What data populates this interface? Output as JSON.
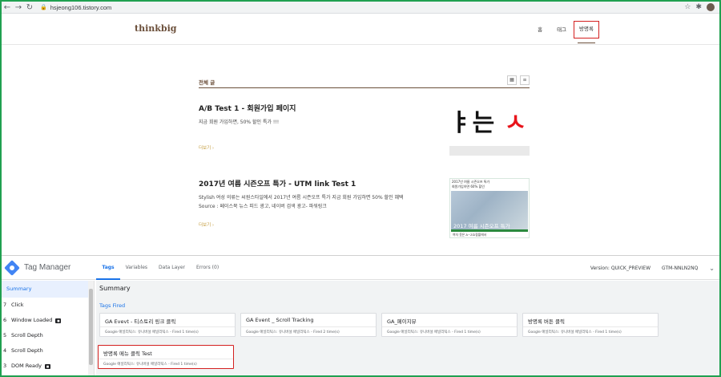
{
  "browser": {
    "url": "hsjeong106.tistory.com",
    "icons": [
      "back-arrow-icon",
      "forward-arrow-icon",
      "reload-icon",
      "lock-icon",
      "star-icon",
      "extensions-icon"
    ]
  },
  "blog": {
    "logo": "thinkbig",
    "nav": [
      "홈",
      "태그",
      "방명록"
    ],
    "section_title": "전체 글",
    "posts": [
      {
        "title": "A/B Test 1 - 회원가입 페이지",
        "excerpt": "지금 회원 가입하면, 50% 할인 특가 !!!",
        "more": "더보기 ›",
        "thumb_text": "ㅑ는 ",
        "thumb_text_red": "ㅅ"
      },
      {
        "title": "2017년 여름 시즌오프 특가 - UTM link Test 1",
        "excerpt_line1": "Stylish 여성 의류는 씨원스타일에서 2017년 여름 시즌오프 특가 지금 회원 가입하면 50% 할인 혜택",
        "excerpt_line2": "Source : 페이스북 뉴스 피드 광고, 네이버 검색 광고- 파워링크",
        "more": "더보기 ›",
        "thumb_top1": "2017년 여름 시즌오프 특가",
        "thumb_top2": "회원가입하면 60% 할인",
        "thumb_caption": "2017 여름 시즌오프 특가",
        "thumb_foot": "여자 옷은 A~Z쇼핑몰에서"
      }
    ]
  },
  "tag_manager": {
    "title": "Tag Manager",
    "tabs": [
      "Tags",
      "Variables",
      "Data Layer",
      "Errors (0)"
    ],
    "version": "Version: QUICK_PREVIEW",
    "container": "GTM-NNLN2NQ",
    "sidebar": {
      "summary": "Summary",
      "events": [
        {
          "num": "7",
          "label": "Click",
          "badge": false
        },
        {
          "num": "6",
          "label": "Window Loaded",
          "badge": true
        },
        {
          "num": "5",
          "label": "Scroll Depth",
          "badge": false
        },
        {
          "num": "4",
          "label": "Scroll Depth",
          "badge": false
        },
        {
          "num": "3",
          "label": "DOM Ready",
          "badge": true
        }
      ]
    },
    "main_title": "Summary",
    "fired_label": "Tags Fired",
    "tags": [
      {
        "name": "GA Evevt - 티스토리 링크 클릭",
        "sub": "Google 애널리틱스: 유니버설 애널리틱스 - Fired 1 time(s)"
      },
      {
        "name": "GA Event _ Scroll Tracking",
        "sub": "Google 애널리틱스: 유니버설 애널리틱스 - Fired 2 time(s)"
      },
      {
        "name": "GA_페이지뷰",
        "sub": "Google 애널리틱스: 유니버설 애널리틱스 - Fired 1 time(s)"
      },
      {
        "name": "방명록 버튼 클릭",
        "sub": "Google 애널리틱스: 유니버설 애널리틱스 - Fired 1 time(s)"
      },
      {
        "name": "방명록 메뉴 클릭 Test",
        "sub": "Google 애널리틱스: 유니버설 애널리틱스 - Fired 1 time(s)"
      }
    ]
  },
  "colors": {
    "highlight": "#d42020",
    "gtm_blue": "#1a73e8",
    "blog_brown": "#6b4f3a",
    "frame_green": "#20a050"
  }
}
